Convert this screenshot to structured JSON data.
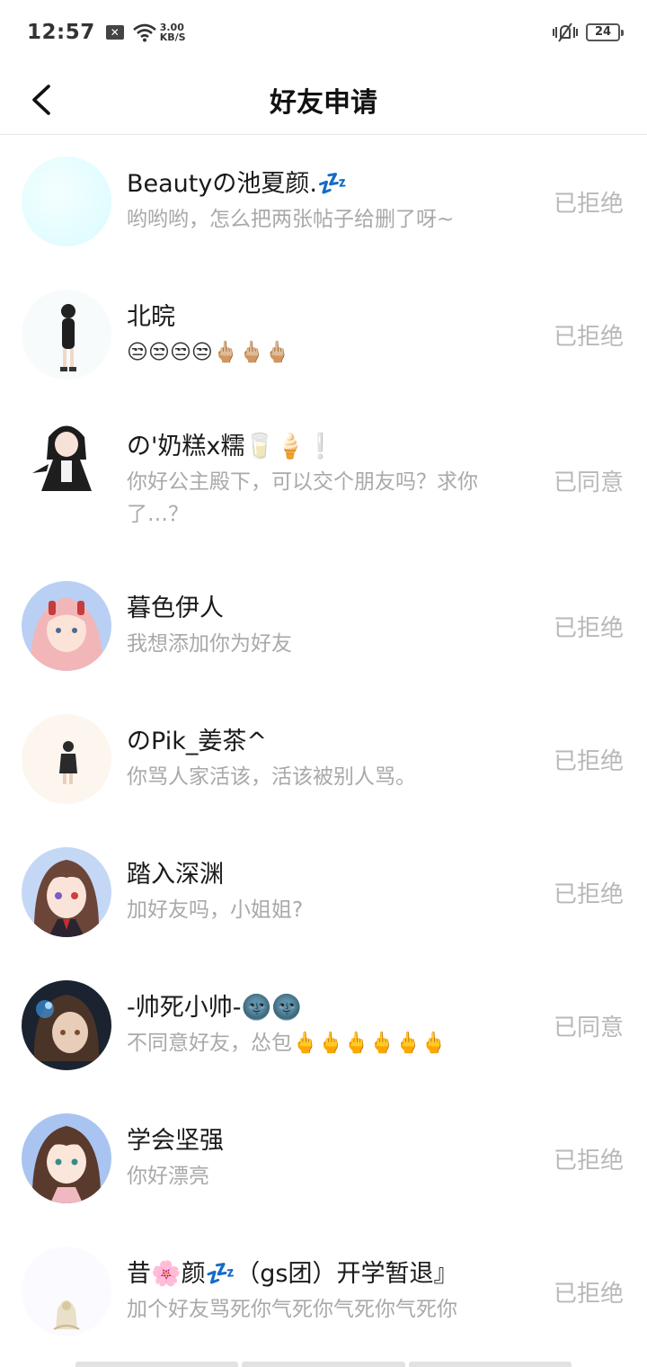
{
  "status_bar": {
    "time": "12:57",
    "x_badge": "✕",
    "speed_value": "3.00",
    "speed_unit": "KB/S",
    "battery": "24"
  },
  "header": {
    "title": "好友申请"
  },
  "requests": [
    {
      "name": "Beautyの池夏颜.💤",
      "message": "哟哟哟，怎么把两张帖子给删了呀~",
      "status": "已拒绝",
      "avatar_icon": "pale-cyan-avatar"
    },
    {
      "name": "北晥",
      "message": "😒😒😒😒🖕🏼🖕🏼🖕🏼",
      "status": "已拒绝",
      "avatar_icon": "standing-girl-avatar"
    },
    {
      "name": "の'奶糕x糯🥛🍦❕",
      "message": "你好公主殿下，可以交个朋友吗？求你了…？",
      "status": "已同意",
      "avatar_icon": "maid-girl-avatar"
    },
    {
      "name": "暮色伊人",
      "message": "我想添加你为好友",
      "status": "已拒绝",
      "avatar_icon": "pink-hair-girl-avatar"
    },
    {
      "name": "のPik_姜茶^",
      "message": "你骂人家活该，活该被别人骂。",
      "status": "已拒绝",
      "avatar_icon": "small-figure-avatar"
    },
    {
      "name": "踏入深渊",
      "message": "加好友吗，小姐姐?",
      "status": "已拒绝",
      "avatar_icon": "brown-hair-girl-avatar"
    },
    {
      "name": "-帅死小帅-🌚🌚",
      "message": "不同意好友，怂包🖕🖕🖕🖕🖕🖕",
      "status": "已同意",
      "avatar_icon": "dark-anime-boy-avatar"
    },
    {
      "name": "学会坚强",
      "message": "你好漂亮",
      "status": "已拒绝",
      "avatar_icon": "anime-girl-avatar"
    },
    {
      "name": "昔🌸颜💤（gs团）开学暂退』",
      "message": "加个好友骂死你气死你气死你气死你",
      "status": "已拒绝",
      "avatar_icon": "faded-figure-avatar"
    }
  ]
}
